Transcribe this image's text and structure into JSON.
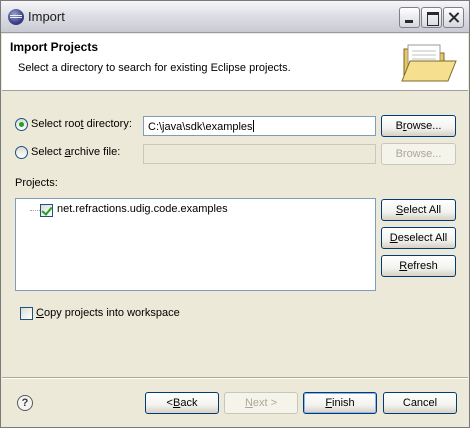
{
  "window": {
    "title": "Import",
    "icon": "eclipse-icon"
  },
  "banner": {
    "title": "Import Projects",
    "description": "Select a directory to search for existing Eclipse projects.",
    "icon": "open-folder-icon"
  },
  "source": {
    "root_directory_label_pre": "Select roo",
    "root_directory_label_mnemonic": "t",
    "root_directory_label_post": " directory:",
    "root_directory_selected": true,
    "root_directory_value": "C:\\java\\sdk\\examples",
    "browse_root_label_pre": "B",
    "browse_root_label_mnemonic": "r",
    "browse_root_label_post": "owse...",
    "archive_label_pre": "Select ",
    "archive_label_mnemonic": "a",
    "archive_label_post": "rchive file:",
    "archive_selected": false,
    "archive_value": "",
    "browse_archive_label": "Browse..."
  },
  "projects": {
    "label": "Projects:",
    "items": [
      {
        "name": "net.refractions.udig.code.examples",
        "checked": true
      }
    ],
    "select_all_pre": "",
    "select_all_mnemonic": "S",
    "select_all_post": "elect All",
    "deselect_all_pre": "",
    "deselect_all_mnemonic": "D",
    "deselect_all_post": "eselect All",
    "refresh_pre": "",
    "refresh_mnemonic": "R",
    "refresh_post": "efresh"
  },
  "options": {
    "copy_into_workspace_pre": "",
    "copy_into_workspace_mnemonic": "C",
    "copy_into_workspace_post": "opy projects into workspace",
    "copy_into_workspace_checked": false
  },
  "footer": {
    "help_glyph": "?",
    "back_pre": "< ",
    "back_mnemonic": "B",
    "back_post": "ack",
    "next_pre": "",
    "next_mnemonic": "N",
    "next_post": "ext >",
    "finish_pre": "",
    "finish_mnemonic": "F",
    "finish_post": "inish",
    "cancel_label": "Cancel"
  }
}
